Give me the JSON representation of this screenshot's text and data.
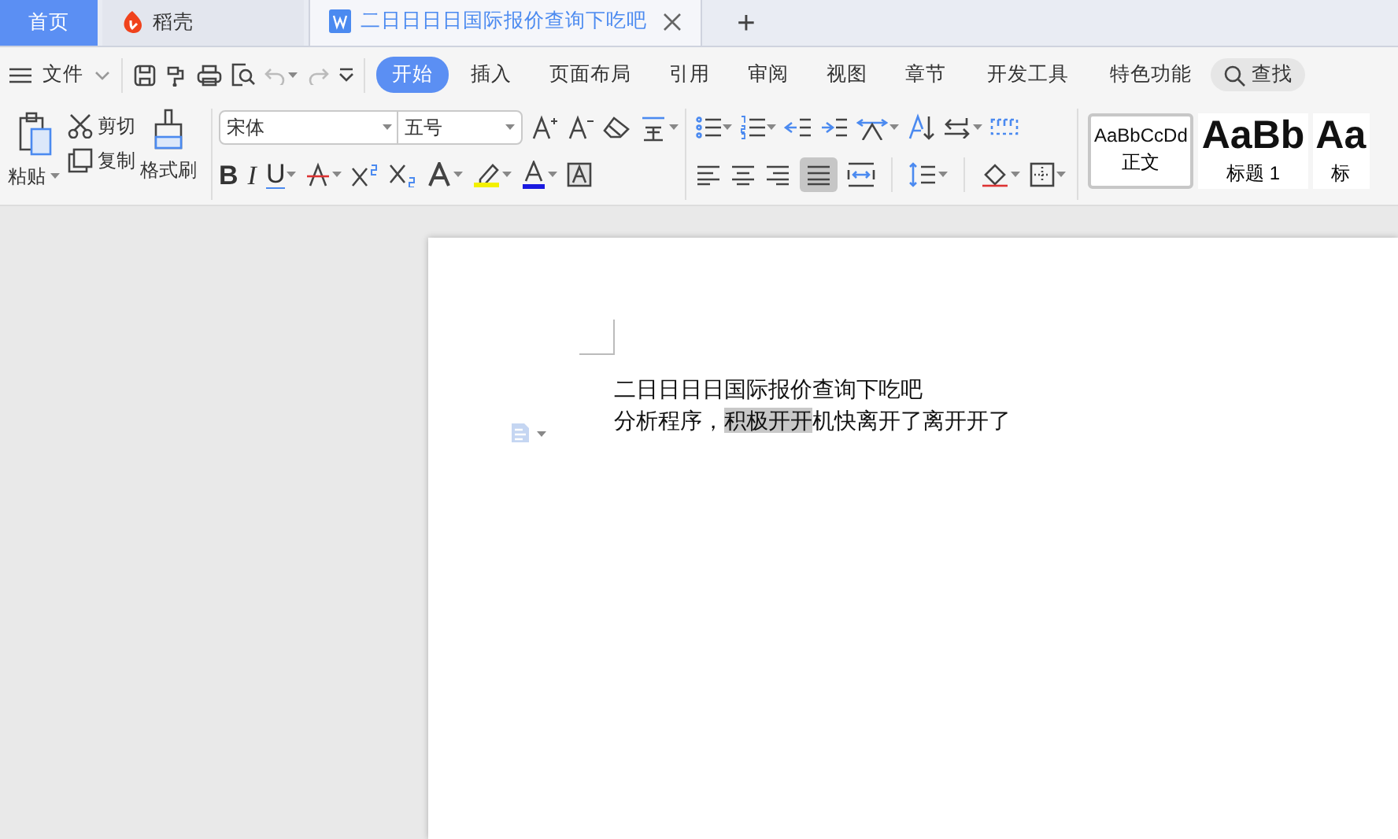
{
  "tabs": [
    {
      "label": "首页",
      "kind": "home",
      "selected": false
    },
    {
      "label": "稻壳",
      "kind": "docer",
      "selected": false
    },
    {
      "label": "二日日日日国际报价查询下吃吧",
      "kind": "document",
      "selected": true
    }
  ],
  "new_tab": "+",
  "menu": {
    "file": "文件",
    "items": [
      {
        "label": "开始",
        "selected": true
      },
      {
        "label": "插入",
        "selected": false
      },
      {
        "label": "页面布局",
        "selected": false
      },
      {
        "label": "引用",
        "selected": false
      },
      {
        "label": "审阅",
        "selected": false
      },
      {
        "label": "视图",
        "selected": false
      },
      {
        "label": "章节",
        "selected": false
      },
      {
        "label": "开发工具",
        "selected": false
      },
      {
        "label": "特色功能",
        "selected": false
      }
    ],
    "search": "查找"
  },
  "ribbon": {
    "paste": "粘贴",
    "cut": "剪切",
    "copy": "复制",
    "format_painter": "格式刷",
    "font": "宋体",
    "size": "五号",
    "bold": "B",
    "italic": "I",
    "underline": "U",
    "justify_selected": true,
    "styles": [
      {
        "preview": "AaBbCcDd",
        "label": "正文",
        "selected": true
      },
      {
        "preview": "AaBb",
        "label": "标题 1",
        "selected": false
      },
      {
        "preview": "Aa",
        "label": "标",
        "selected": false
      }
    ]
  },
  "document": {
    "lines": [
      [
        {
          "text": "二日日日日国际报价查询下吃吧",
          "highlighted": false
        }
      ],
      [
        {
          "text": "分析程序，",
          "highlighted": false
        },
        {
          "text": "积极开开",
          "highlighted": true
        },
        {
          "text": "机快离开了离开开了",
          "highlighted": false
        }
      ]
    ]
  }
}
